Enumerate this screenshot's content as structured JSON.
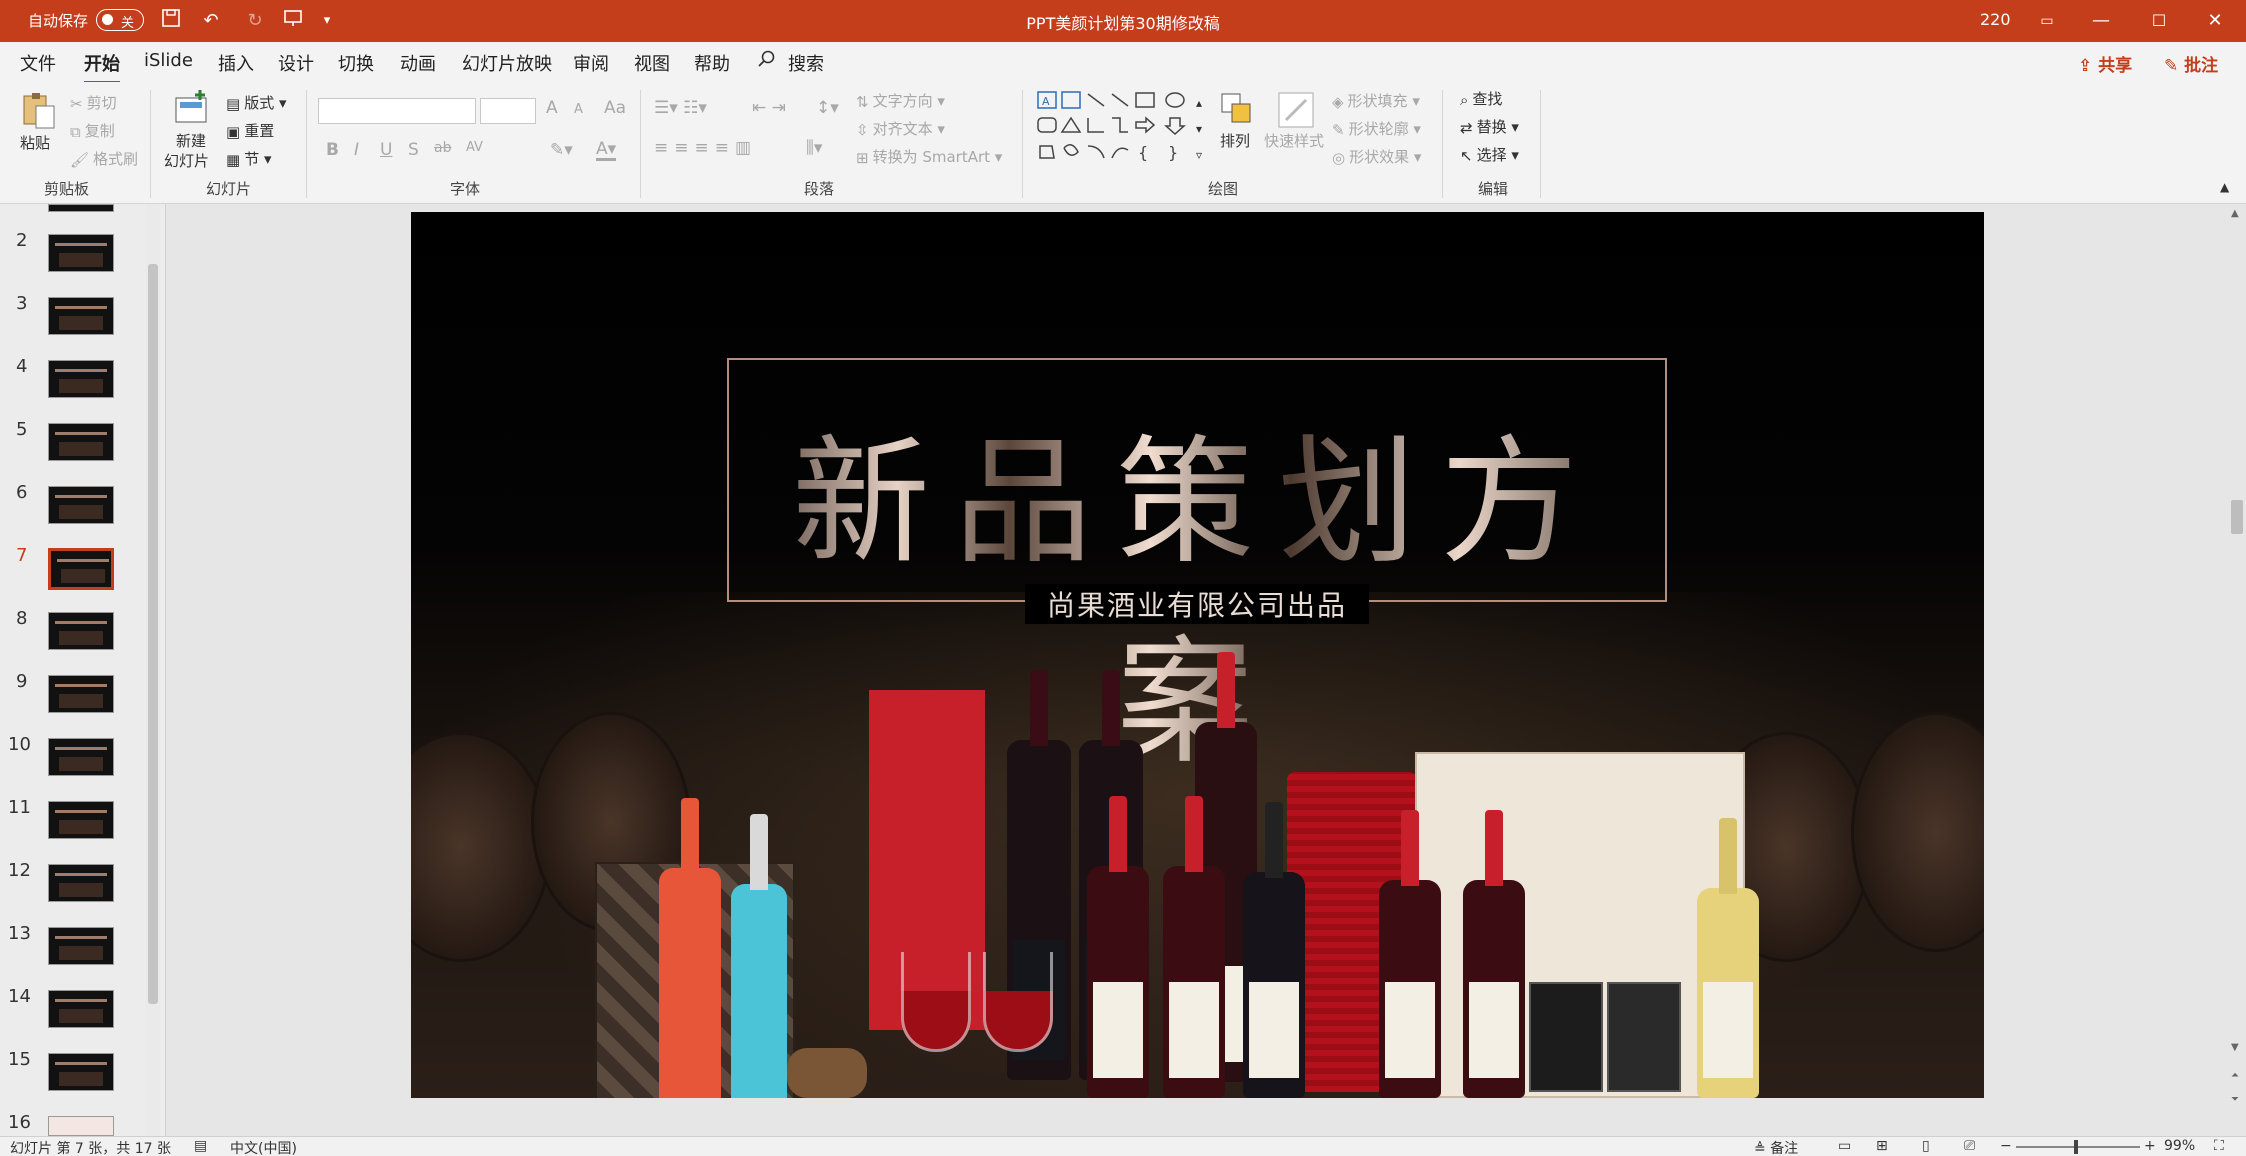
{
  "titlebar": {
    "autosave_label": "自动保存",
    "autosave_state": "关",
    "doc_title": "PPT美颜计划第30期修改稿",
    "count": "220",
    "accent_color": "#c43e1c"
  },
  "tabs": [
    "文件",
    "开始",
    "iSlide",
    "插入",
    "设计",
    "切换",
    "动画",
    "幻灯片放映",
    "审阅",
    "视图",
    "帮助"
  ],
  "active_tab": "开始",
  "search_label": "搜索",
  "share_label": "共享",
  "comment_label": "批注",
  "ribbon": {
    "clipboard": {
      "paste": "粘贴",
      "cut": "剪切",
      "copy": "复制",
      "format_painter": "格式刷",
      "label": "剪贴板"
    },
    "slides": {
      "new_slide_line1": "新建",
      "new_slide_line2": "幻灯片",
      "layout": "版式",
      "reset": "重置",
      "section": "节",
      "label": "幻灯片"
    },
    "font": {
      "label": "字体",
      "bold": "B",
      "italic": "I",
      "underline": "U",
      "strike": "S",
      "shadow": "ab",
      "spacing": "AV",
      "aa": "Aa",
      "grow": "A",
      "shrink": "A"
    },
    "paragraph": {
      "label": "段落",
      "text_direction": "文字方向",
      "align_text": "对齐文本",
      "smartart": "转换为 SmartArt"
    },
    "drawing": {
      "label": "绘图",
      "arrange": "排列",
      "quick_styles": "快速样式",
      "shape_fill": "形状填充",
      "shape_outline": "形状轮廓",
      "shape_effects": "形状效果"
    },
    "editing": {
      "label": "编辑",
      "find": "查找",
      "replace": "替换",
      "select": "选择"
    }
  },
  "thumbnails": [
    "2",
    "3",
    "4",
    "5",
    "6",
    "7",
    "8",
    "9",
    "10",
    "11",
    "12",
    "13",
    "14",
    "15",
    "16"
  ],
  "active_slide": "7",
  "slide": {
    "title": "新品策划方案",
    "subtitle": "尚果酒业有限公司出品"
  },
  "statusbar": {
    "slide_info": "幻灯片 第 7 张，共 17 张",
    "language": "中文(中国)",
    "notes": "备注",
    "zoom": "99%"
  }
}
